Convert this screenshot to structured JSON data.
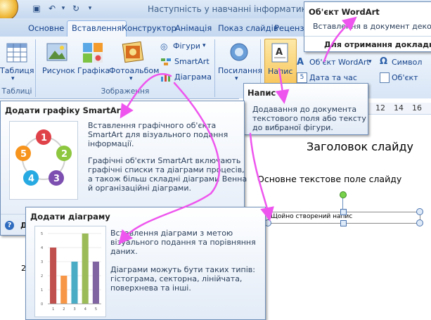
{
  "title_bar": {
    "title": "Наступність у навчанні інформатики.ppt"
  },
  "tabs": [
    "Основне",
    "Вставлення",
    "Конструктор",
    "Анімація",
    "Показ слайдів",
    "Рецензу"
  ],
  "ribbon": {
    "table_label": "Таблиця",
    "picture_label": "Рисунок",
    "clipart_label": "Графіка",
    "album_label": "Фотоальбом",
    "shapes_label": "Фігури",
    "smartart_label": "SmartArt",
    "chart_label": "Діаграма",
    "links_label": "Посилання",
    "textbox_label": "Напис",
    "wordart_label": "Об'єкт WordArt",
    "symbol_label": "Символ",
    "datetime_label": "Дата та час",
    "object_label": "Об'єкт",
    "groups": {
      "tables": "Таблиці",
      "illustrations": "Зображення"
    }
  },
  "wordart_tooltip": {
    "title": "Об'єкт WordArt",
    "text": "Вставлення в документ декорат",
    "help": "Для отримання докладної д"
  },
  "textbox_tooltip": {
    "title": "Напис",
    "text": [
      "Додавання до документа",
      "текстового поля або тексту",
      "до вибраної фігури."
    ]
  },
  "smartart_tooltip": {
    "title": "Додати графіку SmartArt",
    "p1": [
      "Вставлення графічного об'єкта",
      "SmartArt для візуального подання",
      "інформації."
    ],
    "p2": [
      "Графічні об'єкти SmartArt включають",
      "графічні списки та діаграми процесів,",
      "а також більш складні діаграми Венна",
      "й організаційні діаграми."
    ],
    "help_icon": "?",
    "help_fragment": "Д",
    "diagram_numbers": [
      "1",
      "2",
      "3",
      "4",
      "5"
    ]
  },
  "chart_tooltip": {
    "title": "Додати діаграму",
    "p1": [
      "Вставлення діаграми з метою",
      "візуального подання та порівняння",
      "даних."
    ],
    "p2": [
      "Діаграми можуть бути таких типів:",
      "гістограма, секторна, лінійчата,",
      "поверхнева та інші."
    ]
  },
  "chart_data": {
    "type": "bar",
    "categories": [
      "1",
      "2",
      "3",
      "4",
      "5"
    ],
    "values": [
      4,
      2,
      3,
      5,
      3
    ],
    "ylim": [
      0,
      5
    ],
    "yticks": [
      "0",
      "1",
      "2",
      "3",
      "4",
      "5"
    ],
    "colors": [
      "#c0504d",
      "#f79646",
      "#4bacc6",
      "#9bbb59",
      "#8064a2"
    ]
  },
  "ruler": [
    "12",
    "14",
    "16"
  ],
  "slide": {
    "title": "Заголовок слайду",
    "body": "Основне текстове поле слайду",
    "textbox": "Щойно створений напис",
    "left_fragment": "2"
  },
  "colors": {
    "accent_arrow": "#ee55ee",
    "ribbon_text": "#15428b"
  }
}
